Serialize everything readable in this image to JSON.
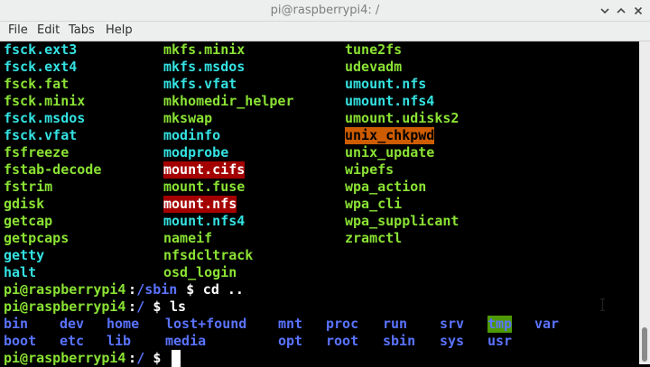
{
  "window": {
    "title": "pi@raspberrypi4: /",
    "menu": [
      "File",
      "Edit",
      "Tabs",
      "Help"
    ]
  },
  "colors": {
    "cyan": "#34e2e2",
    "green": "#8ae234",
    "blue": "#5a73ff",
    "white": "#ffffff",
    "red_bg": "#a40000",
    "orange_bg": "#ce5c00",
    "dir_tmp_bg": "#4e9a06"
  },
  "listing_rows": [
    [
      {
        "t": "fsck.ext3",
        "c": "cyan"
      },
      {
        "t": "mkfs.minix",
        "c": "green"
      },
      {
        "t": "tune2fs",
        "c": "green"
      }
    ],
    [
      {
        "t": "fsck.ext4",
        "c": "cyan"
      },
      {
        "t": "mkfs.msdos",
        "c": "cyan"
      },
      {
        "t": "udevadm",
        "c": "green"
      }
    ],
    [
      {
        "t": "fsck.fat",
        "c": "green"
      },
      {
        "t": "mkfs.vfat",
        "c": "cyan"
      },
      {
        "t": "umount.nfs",
        "c": "cyan"
      }
    ],
    [
      {
        "t": "fsck.minix",
        "c": "green"
      },
      {
        "t": "mkhomedir_helper",
        "c": "green"
      },
      {
        "t": "umount.nfs4",
        "c": "cyan"
      }
    ],
    [
      {
        "t": "fsck.msdos",
        "c": "cyan"
      },
      {
        "t": "mkswap",
        "c": "green"
      },
      {
        "t": "umount.udisks2",
        "c": "green"
      }
    ],
    [
      {
        "t": "fsck.vfat",
        "c": "cyan"
      },
      {
        "t": "modinfo",
        "c": "cyan"
      },
      {
        "t": "unix_chkpwd",
        "c": "black",
        "bg": "orange_bg"
      }
    ],
    [
      {
        "t": "fsfreeze",
        "c": "green"
      },
      {
        "t": "modprobe",
        "c": "cyan"
      },
      {
        "t": "unix_update",
        "c": "green"
      }
    ],
    [
      {
        "t": "fstab-decode",
        "c": "green"
      },
      {
        "t": "mount.cifs",
        "c": "white",
        "bg": "red_bg"
      },
      {
        "t": "wipefs",
        "c": "green"
      }
    ],
    [
      {
        "t": "fstrim",
        "c": "green"
      },
      {
        "t": "mount.fuse",
        "c": "green"
      },
      {
        "t": "wpa_action",
        "c": "green"
      }
    ],
    [
      {
        "t": "gdisk",
        "c": "green"
      },
      {
        "t": "mount.nfs",
        "c": "white",
        "bg": "red_bg"
      },
      {
        "t": "wpa_cli",
        "c": "green"
      }
    ],
    [
      {
        "t": "getcap",
        "c": "green"
      },
      {
        "t": "mount.nfs4",
        "c": "cyan"
      },
      {
        "t": "wpa_supplicant",
        "c": "green"
      }
    ],
    [
      {
        "t": "getpcaps",
        "c": "green"
      },
      {
        "t": "nameif",
        "c": "green"
      },
      {
        "t": "zramctl",
        "c": "green"
      }
    ],
    [
      {
        "t": "getty",
        "c": "cyan"
      },
      {
        "t": "nfsdcltrack",
        "c": "green"
      }
    ],
    [
      {
        "t": "halt",
        "c": "cyan"
      },
      {
        "t": "osd_login",
        "c": "green"
      }
    ]
  ],
  "prompts": [
    {
      "user": "pi@raspberrypi4",
      "sep": ":",
      "path": "/sbin",
      "symbol": " $ ",
      "command": "cd .."
    },
    {
      "user": "pi@raspberrypi4",
      "sep": ":",
      "path": "/",
      "symbol": " $ ",
      "command": "ls"
    },
    {
      "user": "pi@raspberrypi4",
      "sep": ":",
      "path": "/",
      "symbol": " $ ",
      "command": ""
    }
  ],
  "ls_rows": [
    [
      "bin",
      "dev",
      "home",
      "lost+found",
      "mnt",
      "proc",
      "run",
      "srv",
      "tmp",
      "var"
    ],
    [
      "boot",
      "etc",
      "lib",
      "media",
      "opt",
      "root",
      "sbin",
      "sys",
      "usr"
    ]
  ]
}
